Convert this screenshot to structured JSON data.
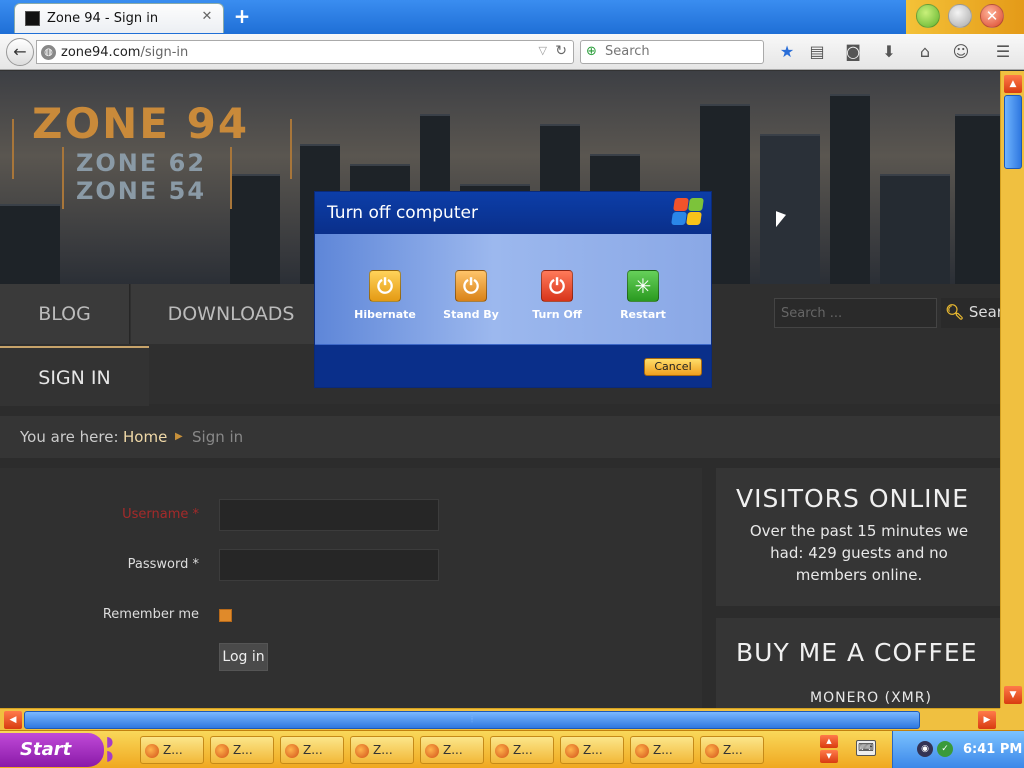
{
  "browser": {
    "tab_title": "Zone 94 - Sign in",
    "url_domain": "zone94.com",
    "url_path": "/sign-in",
    "search_placeholder": "Search",
    "icons": [
      "bookmark-star-icon",
      "reading-list-icon",
      "pocket-icon",
      "download-icon",
      "home-icon",
      "smiley-icon",
      "menu-icon"
    ]
  },
  "site": {
    "logo_line1": "ZONE 94",
    "logo_line2": "ZONE 62",
    "logo_line3": "ZONE 54",
    "menu": {
      "blog": "BLOG",
      "downloads": "DOWNLOADS",
      "sign_in": "SIGN IN"
    },
    "search_placeholder": "Search ...",
    "search_button": "Search",
    "breadcrumb": {
      "label": "You are here:",
      "home": "Home",
      "current": "Sign in"
    },
    "form": {
      "username_label": "Username *",
      "password_label": "Password *",
      "remember_label": "Remember me",
      "login_button": "Log in"
    },
    "visitors": {
      "title": "VISITORS ONLINE",
      "text": "Over the past 15 minutes we had: 429 guests and no members online."
    },
    "coffee": {
      "title": "BUY ME A COFFEE",
      "subtitle": "MONERO (XMR)"
    }
  },
  "dialog": {
    "title": "Turn off computer",
    "options": {
      "hibernate": "Hibernate",
      "stand_by": "Stand By",
      "turn_off": "Turn Off",
      "restart": "Restart"
    },
    "cancel": "Cancel"
  },
  "taskbar": {
    "start": "Start",
    "button_label": "Z...",
    "clock": "6:41 PM"
  }
}
